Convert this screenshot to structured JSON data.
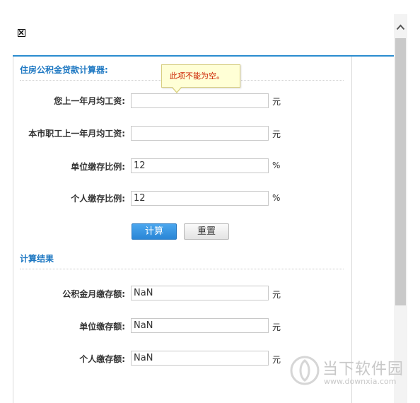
{
  "form": {
    "section_title": "住房公积金贷款计算器:",
    "tooltip": "此项不能为空。",
    "rows": [
      {
        "label": "您上一年月均工资:",
        "value": "",
        "unit": "元"
      },
      {
        "label": "本市职工上一年月均工资:",
        "value": "",
        "unit": "元"
      },
      {
        "label": "单位缴存比例:",
        "value": "12",
        "unit": "%"
      },
      {
        "label": "个人缴存比例:",
        "value": "12",
        "unit": "%"
      }
    ],
    "calc_button": "计算",
    "reset_button": "重置"
  },
  "results": {
    "section_title": "计算结果",
    "rows": [
      {
        "label": "公积金月缴存额:",
        "value": "NaN",
        "unit": "元"
      },
      {
        "label": "单位缴存额:",
        "value": "NaN",
        "unit": "元"
      },
      {
        "label": "个人缴存额:",
        "value": "NaN",
        "unit": "元"
      }
    ]
  },
  "watermark": {
    "name": "当下软件园",
    "url": "www.downxia.com"
  },
  "colors": {
    "accent": "#1e78c2",
    "button_primary": "#2a86d6",
    "tooltip_text": "#cc2200"
  }
}
